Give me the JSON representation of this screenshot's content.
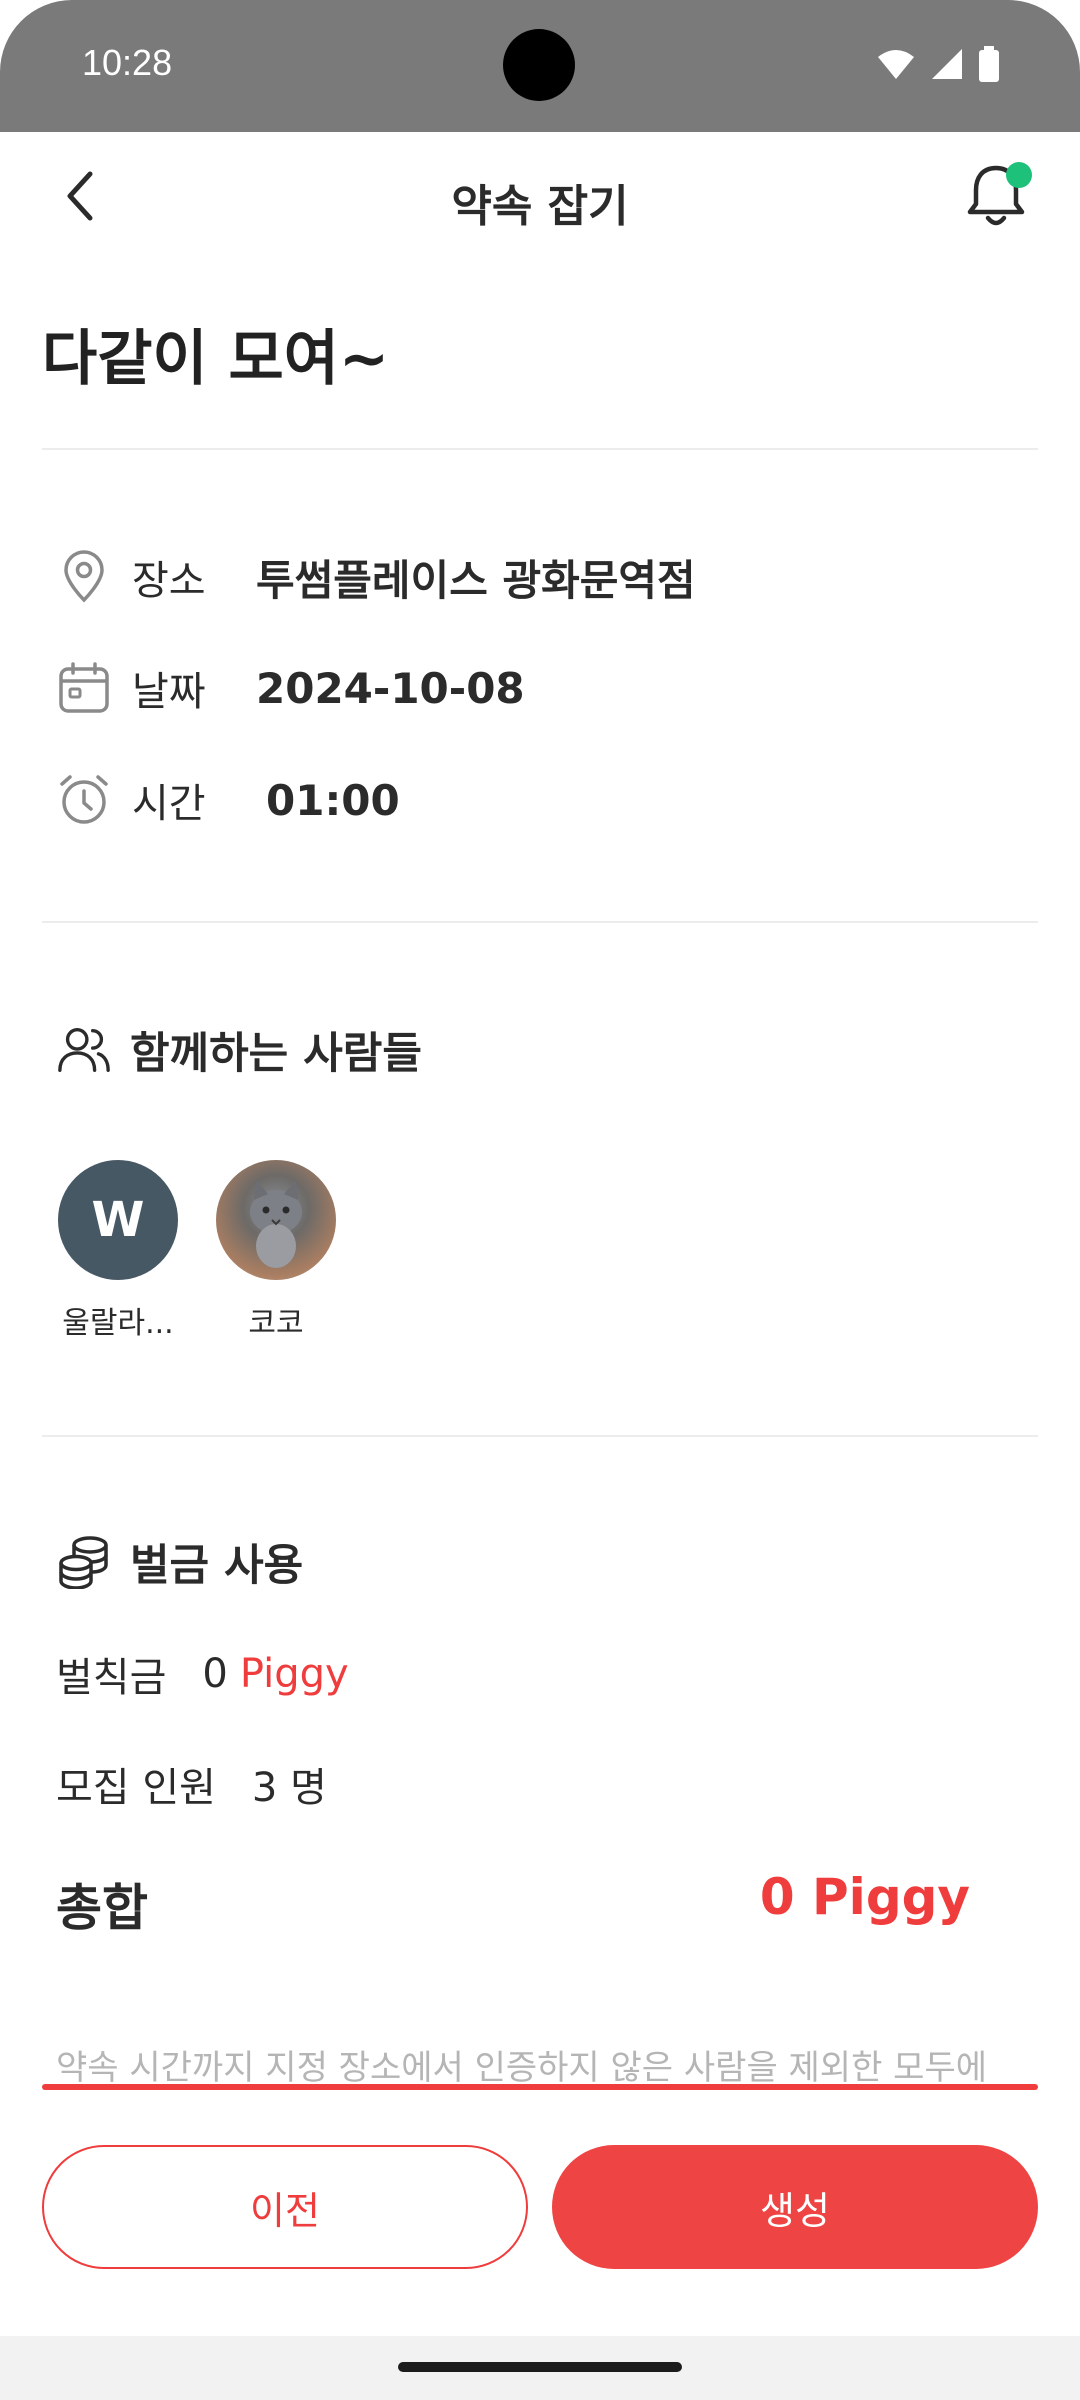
{
  "status_bar": {
    "time": "10:28"
  },
  "app_bar": {
    "title": "약속 잡기"
  },
  "page": {
    "title": "다같이 모여~"
  },
  "details": {
    "place_label": "장소",
    "place_value": "투썸플레이스 광화문역점",
    "date_label": "날짜",
    "date_value": "2024-10-08",
    "time_label": "시간",
    "time_value": "01:00"
  },
  "members": {
    "title": "함께하는 사람들",
    "list": [
      {
        "initial": "W",
        "name": "울랄라..."
      },
      {
        "initial": "",
        "name": "코코"
      }
    ]
  },
  "fine": {
    "title": "벌금 사용",
    "penalty_label": "벌칙금",
    "penalty_amount": "0",
    "penalty_unit": "Piggy",
    "recruit_label": "모집 인원",
    "recruit_value": "3 명",
    "total_label": "총합",
    "total_value": "0 Piggy"
  },
  "notice": "약속 시간까지 지정 장소에서 인증하지 않은 사람을 제외한 모두에",
  "buttons": {
    "prev": "이전",
    "create": "생성"
  },
  "colors": {
    "accent": "#ef4444",
    "notification_dot": "#1ec17a",
    "avatar_bg": "#475865"
  }
}
